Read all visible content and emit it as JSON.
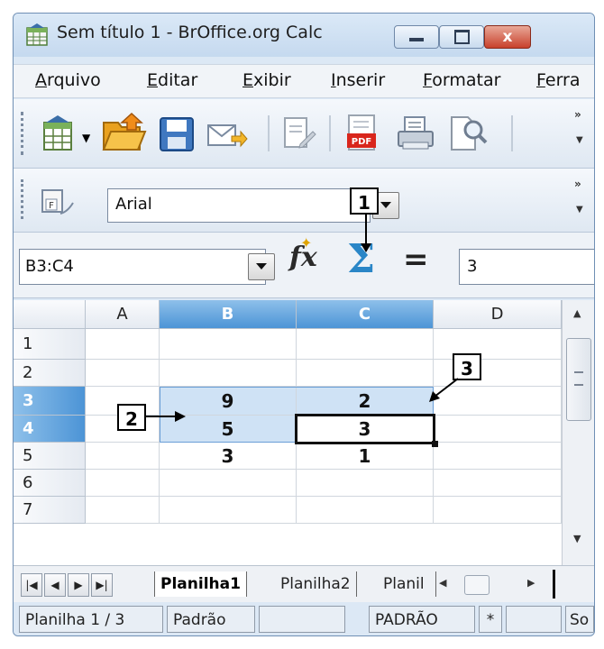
{
  "window": {
    "title": "Sem título 1 - BrOffice.org Calc",
    "controls": {
      "close": "x"
    }
  },
  "menu": [
    {
      "label": "Arquivo"
    },
    {
      "label": "Editar"
    },
    {
      "label": "Exibir"
    },
    {
      "label": "Inserir"
    },
    {
      "label": "Formatar"
    },
    {
      "label": "Ferra"
    }
  ],
  "toolbar": {
    "overflow": "»",
    "icons": [
      "new-document-icon",
      "open-folder-icon",
      "save-icon",
      "email-icon",
      "edit-file-icon",
      "export-pdf-icon",
      "print-icon",
      "page-preview-icon"
    ]
  },
  "formatting": {
    "font_name": "Arial"
  },
  "formula_bar": {
    "name_box": "B3:C4",
    "input": "3",
    "fx": "fx",
    "sum": "Σ",
    "equals": "="
  },
  "callouts": {
    "one": "1",
    "two": "2",
    "three": "3"
  },
  "sheet": {
    "columns": [
      "A",
      "B",
      "C",
      "D"
    ],
    "rows": [
      "1",
      "2",
      "3",
      "4",
      "5",
      "6",
      "7"
    ],
    "selected_columns": [
      "B",
      "C"
    ],
    "selected_rows": [
      "3",
      "4"
    ],
    "active_cell": "C4",
    "cells": {
      "B3": "9",
      "C3": "2",
      "B4": "5",
      "C4": "3",
      "B5": "3",
      "C5": "1"
    }
  },
  "tabs": {
    "sheet1": "Planilha1",
    "sheet2": "Planilha2",
    "sheet3": "Planil"
  },
  "status": {
    "sheet_info": "Planilha 1 / 3",
    "page_style": "Padrão",
    "insert_mode": "PADRÃO",
    "modified": "*",
    "last": "So"
  }
}
